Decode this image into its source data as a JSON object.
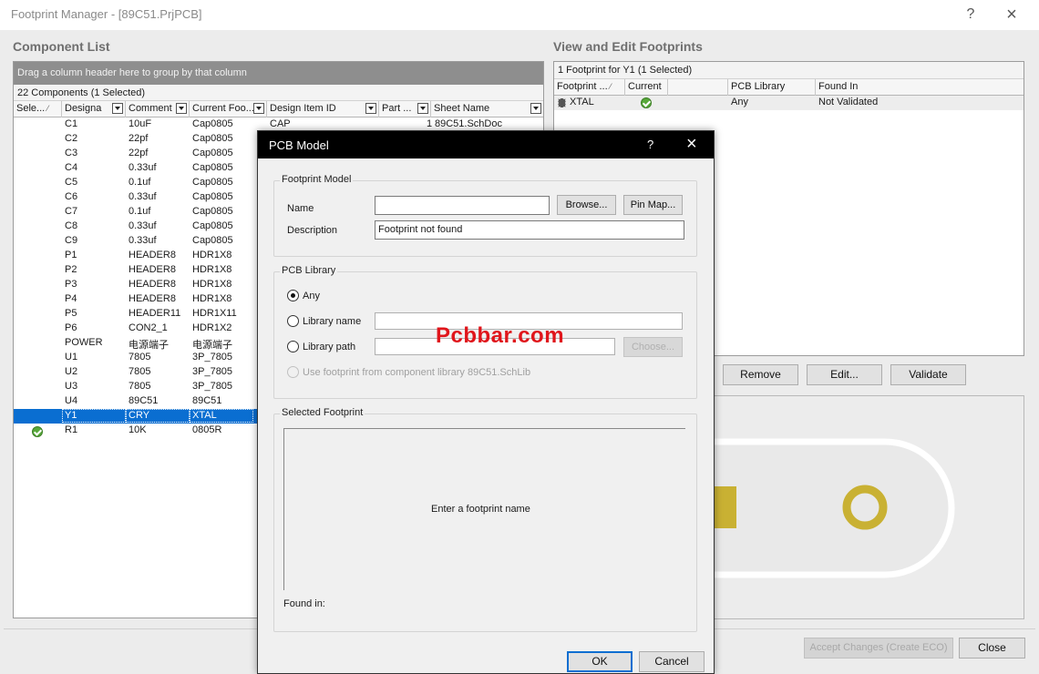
{
  "window": {
    "title": "Footprint Manager - [89C51.PrjPCB]",
    "help_label": "?",
    "close_label": "×"
  },
  "component_list": {
    "title": "Component List",
    "group_hint": "Drag a column header here to group by that column",
    "count_text": "22 Components (1 Selected)",
    "columns": [
      "Sele...",
      "Designa",
      "Comment",
      "Current Foo...",
      "Design Item ID",
      "Part ...",
      "Sheet Name"
    ],
    "first_row": {
      "designator": "C1",
      "comment": "10uF",
      "footprint": "Cap0805",
      "design_item": "CAP",
      "part": "1",
      "sheet": "89C51.SchDoc"
    },
    "rows": [
      {
        "designator": "C2",
        "comment": "22pf",
        "footprint": "Cap0805"
      },
      {
        "designator": "C3",
        "comment": "22pf",
        "footprint": "Cap0805"
      },
      {
        "designator": "C4",
        "comment": "0.33uf",
        "footprint": "Cap0805"
      },
      {
        "designator": "C5",
        "comment": "0.1uf",
        "footprint": "Cap0805"
      },
      {
        "designator": "C6",
        "comment": "0.33uf",
        "footprint": "Cap0805"
      },
      {
        "designator": "C7",
        "comment": "0.1uf",
        "footprint": "Cap0805"
      },
      {
        "designator": "C8",
        "comment": "0.33uf",
        "footprint": "Cap0805"
      },
      {
        "designator": "C9",
        "comment": "0.33uf",
        "footprint": "Cap0805"
      },
      {
        "designator": "P1",
        "comment": "HEADER8",
        "footprint": "HDR1X8"
      },
      {
        "designator": "P2",
        "comment": "HEADER8",
        "footprint": "HDR1X8"
      },
      {
        "designator": "P3",
        "comment": "HEADER8",
        "footprint": "HDR1X8"
      },
      {
        "designator": "P4",
        "comment": "HEADER8",
        "footprint": "HDR1X8"
      },
      {
        "designator": "P5",
        "comment": "HEADER11",
        "footprint": "HDR1X11"
      },
      {
        "designator": "P6",
        "comment": "CON2_1",
        "footprint": "HDR1X2"
      },
      {
        "designator": "POWER",
        "comment": "电源端子",
        "footprint": "电源端子"
      },
      {
        "designator": "U1",
        "comment": "7805",
        "footprint": "3P_7805"
      },
      {
        "designator": "U2",
        "comment": "7805",
        "footprint": "3P_7805"
      },
      {
        "designator": "U3",
        "comment": "7805",
        "footprint": "3P_7805"
      },
      {
        "designator": "U4",
        "comment": "89C51",
        "footprint": "89C51"
      },
      {
        "designator": "Y1",
        "comment": "CRY",
        "footprint": "XTAL",
        "selected": true
      },
      {
        "designator": "R1",
        "comment": "10K",
        "footprint": "0805R",
        "check": true
      }
    ]
  },
  "footprints": {
    "title": "View and Edit Footprints",
    "count_text": "1 Footprint for Y1 (1 Selected)",
    "columns": [
      "Footprint ...",
      "Current",
      "PCB Library",
      "Found In"
    ],
    "row": {
      "name": "XTAL",
      "library": "Any",
      "found_in": "Not Validated"
    },
    "buttons": {
      "remove": "Remove",
      "edit": "Edit...",
      "validate": "Validate"
    }
  },
  "bottom": {
    "accept_label": "Accept Changes (Create ECO)",
    "close_label": "Close"
  },
  "dialog": {
    "title": "PCB Model",
    "help_label": "?",
    "close_label": "×",
    "footprint_model": {
      "label": "Footprint Model",
      "name_label": "Name",
      "name_value": "",
      "browse_label": "Browse...",
      "pinmap_label": "Pin Map...",
      "description_label": "Description",
      "description_value": "Footprint not found"
    },
    "pcb_library": {
      "label": "PCB Library",
      "any_label": "Any",
      "library_name_label": "Library name",
      "library_path_label": "Library path",
      "choose_label": "Choose...",
      "use_component_label": "Use footprint from component library 89C51.SchLib"
    },
    "selected_footprint": {
      "label": "Selected Footprint",
      "hint": "Enter a footprint name",
      "found_in_label": "Found in:"
    },
    "ok_label": "OK",
    "cancel_label": "Cancel"
  },
  "watermark": "Pcbbar.com",
  "colors": {
    "selection": "#0a6ed1",
    "pad": "#c9b133",
    "watermark": "#e0151b"
  }
}
